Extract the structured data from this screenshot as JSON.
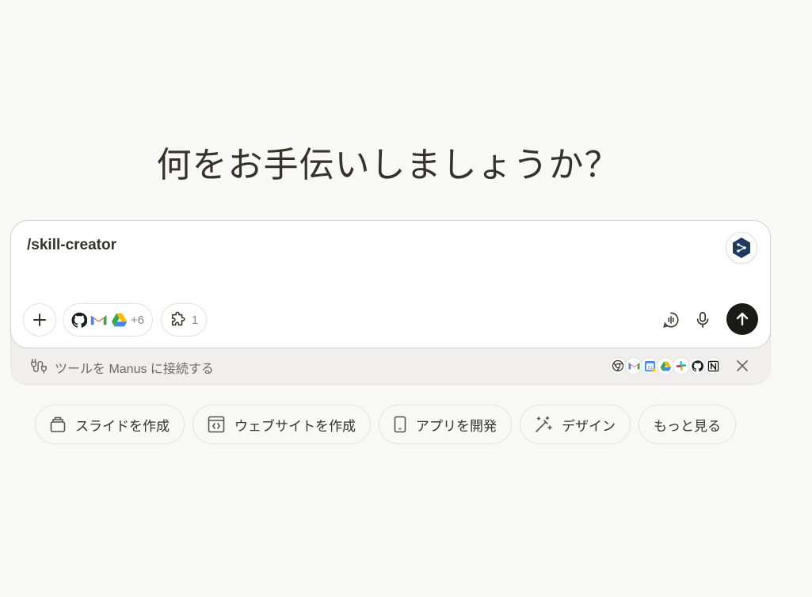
{
  "headline": "何をお手伝いしましょうか？",
  "composer": {
    "input_value": "/skill-creator",
    "skill_badge_icon": "skill-hexagon-icon",
    "plus_icon": "plus-icon",
    "connectors": {
      "icons": [
        "github-icon",
        "gmail-icon",
        "google-drive-icon"
      ],
      "extra_count": "+6"
    },
    "plugins": {
      "icon": "puzzle-icon",
      "count": "1"
    },
    "voice_icon": "voice-chat-icon",
    "mic_icon": "microphone-icon",
    "send_icon": "arrow-up-icon",
    "send_color": "#1a1a19"
  },
  "tools_bar": {
    "label": "ツールを Manus に接続する",
    "icon": "plug-icon",
    "tool_icons": [
      "chrome-icon",
      "gmail-icon",
      "google-calendar-icon",
      "google-drive-icon",
      "slack-icon",
      "github-icon",
      "notion-icon"
    ],
    "close_icon": "close-icon"
  },
  "suggestions": [
    {
      "label": "スライドを作成",
      "icon": "slides-icon"
    },
    {
      "label": "ウェブサイトを作成",
      "icon": "website-icon"
    },
    {
      "label": "アプリを開発",
      "icon": "mobile-icon"
    },
    {
      "label": "デザイン",
      "icon": "magic-wand-icon"
    },
    {
      "label": "もっと見る",
      "icon": ""
    }
  ]
}
